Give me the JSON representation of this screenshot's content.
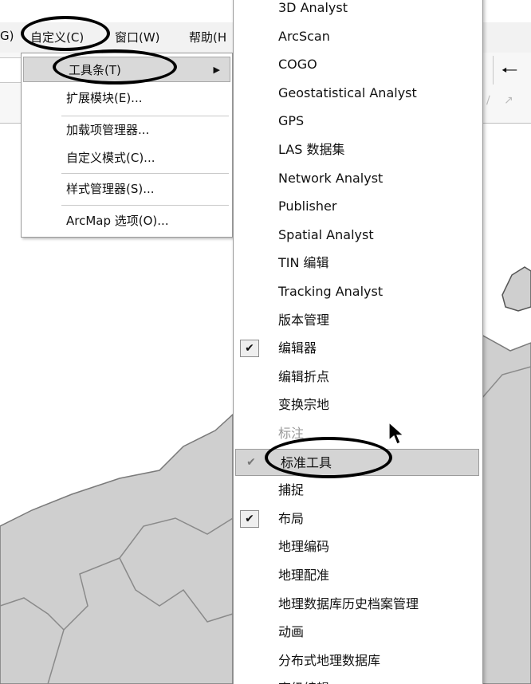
{
  "menubar": {
    "items": [
      "G)",
      "自定义(C)",
      "窗口(W)",
      "帮助(H"
    ]
  },
  "toolbar": {
    "back_icon": "arrow-left-icon"
  },
  "customize_menu": {
    "items": [
      {
        "label": "工具条(T)",
        "highlighted": true,
        "has_submenu": true
      },
      {
        "label": "扩展模块(E)..."
      },
      {
        "label": "加载项管理器..."
      },
      {
        "label": "自定义模式(C)..."
      },
      {
        "label": "样式管理器(S)..."
      },
      {
        "label": "ArcMap 选项(O)..."
      }
    ]
  },
  "toolbars_submenu": {
    "items": [
      {
        "label": "3D Analyst",
        "checked": false
      },
      {
        "label": "ArcScan",
        "checked": false
      },
      {
        "label": "COGO",
        "checked": false
      },
      {
        "label": "Geostatistical Analyst",
        "checked": false
      },
      {
        "label": "GPS",
        "checked": false
      },
      {
        "label": "LAS 数据集",
        "checked": false
      },
      {
        "label": "Network Analyst",
        "checked": false
      },
      {
        "label": "Publisher",
        "checked": false
      },
      {
        "label": "Spatial Analyst",
        "checked": false
      },
      {
        "label": "TIN 编辑",
        "checked": false
      },
      {
        "label": "Tracking Analyst",
        "checked": false
      },
      {
        "label": "版本管理",
        "checked": false
      },
      {
        "label": "编辑器",
        "checked": true
      },
      {
        "label": "编辑折点",
        "checked": false
      },
      {
        "label": "变换宗地",
        "checked": false
      },
      {
        "label": "标注",
        "checked": false,
        "faded": true
      },
      {
        "label": "标准工具",
        "checked": true,
        "highlighted": true
      },
      {
        "label": "捕捉",
        "checked": false
      },
      {
        "label": "布局",
        "checked": true
      },
      {
        "label": "地理编码",
        "checked": false
      },
      {
        "label": "地理配准",
        "checked": false
      },
      {
        "label": "地理数据库历史档案管理",
        "checked": false
      },
      {
        "label": "动画",
        "checked": false
      },
      {
        "label": "分布式地理数据库",
        "checked": false
      },
      {
        "label": "高级编辑",
        "checked": false
      }
    ]
  },
  "colors": {
    "map_fill": "#cfcfcf",
    "menu_bg": "#ffffff",
    "highlight": "#d4d4d4"
  }
}
